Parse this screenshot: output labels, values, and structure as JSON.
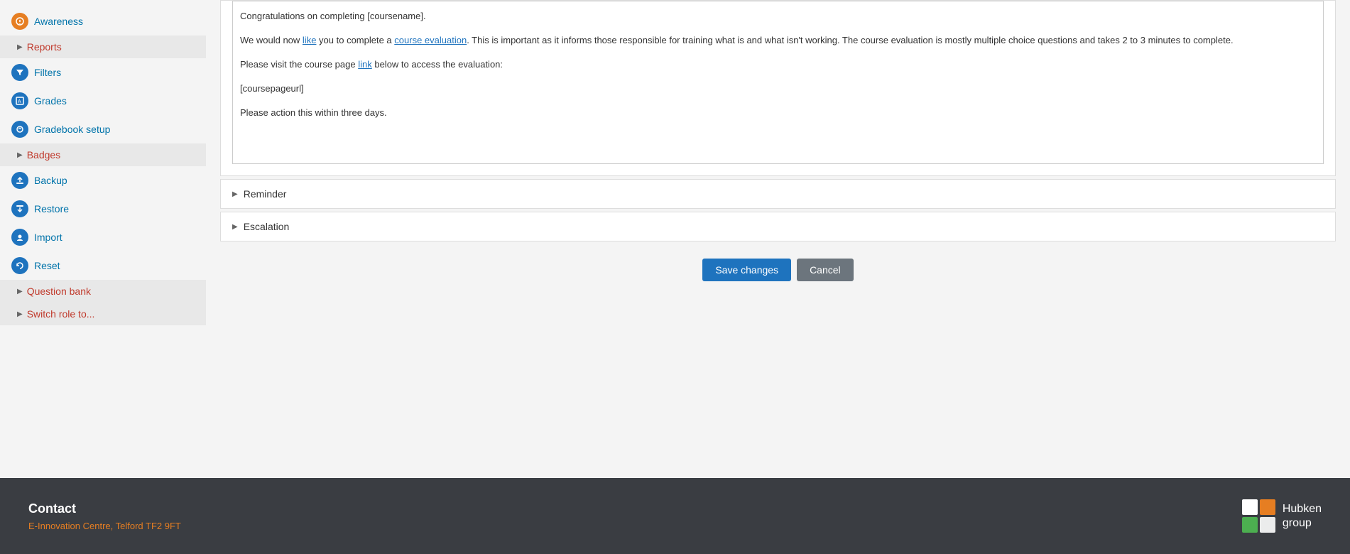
{
  "sidebar": {
    "items": [
      {
        "id": "awareness",
        "label": "Awareness",
        "icon": "A",
        "icon_color": "orange"
      },
      {
        "id": "filters",
        "label": "Filters",
        "icon": "F",
        "icon_color": "blue"
      },
      {
        "id": "grades",
        "label": "Grades",
        "icon": "G",
        "icon_color": "blue"
      },
      {
        "id": "gradebook_setup",
        "label": "Gradebook setup",
        "icon": "S",
        "icon_color": "blue"
      },
      {
        "id": "backup",
        "label": "Backup",
        "icon": "B",
        "icon_color": "blue"
      },
      {
        "id": "restore",
        "label": "Restore",
        "icon": "R",
        "icon_color": "blue"
      },
      {
        "id": "import",
        "label": "Import",
        "icon": "I",
        "icon_color": "blue"
      },
      {
        "id": "reset",
        "label": "Reset",
        "icon": "Re",
        "icon_color": "blue"
      }
    ],
    "collapsibles": [
      {
        "id": "reports",
        "label": "Reports"
      },
      {
        "id": "badges",
        "label": "Badges"
      },
      {
        "id": "question_bank",
        "label": "Question bank"
      },
      {
        "id": "switch_role",
        "label": "Switch role to..."
      }
    ]
  },
  "email_content": {
    "line1": "Congratulations on completing [coursename].",
    "line2": "We would now like you to complete a course evaluation. This is important as it informs those responsible for training what is and what isn't working. The course evaluation is mostly multiple choice questions and takes 2 to 3 minutes to complete.",
    "line2_link_text": "like",
    "line2_link_text2": "course evaluation",
    "line3": "Please visit the course page",
    "line3_link": "link",
    "line3_rest": "below to access the evaluation:",
    "line4": "[coursepageurl]",
    "line5": "Please action this within three days."
  },
  "accordions": {
    "reminder": {
      "label": "Reminder"
    },
    "escalation": {
      "label": "Escalation"
    }
  },
  "buttons": {
    "save": "Save changes",
    "cancel": "Cancel"
  },
  "footer": {
    "contact_heading": "Contact",
    "address_plain": "E-Innovation Centre, Telford ",
    "address_link": "TF2 9FT",
    "logo_text_line1": "Hubken",
    "logo_text_line2": "group"
  }
}
